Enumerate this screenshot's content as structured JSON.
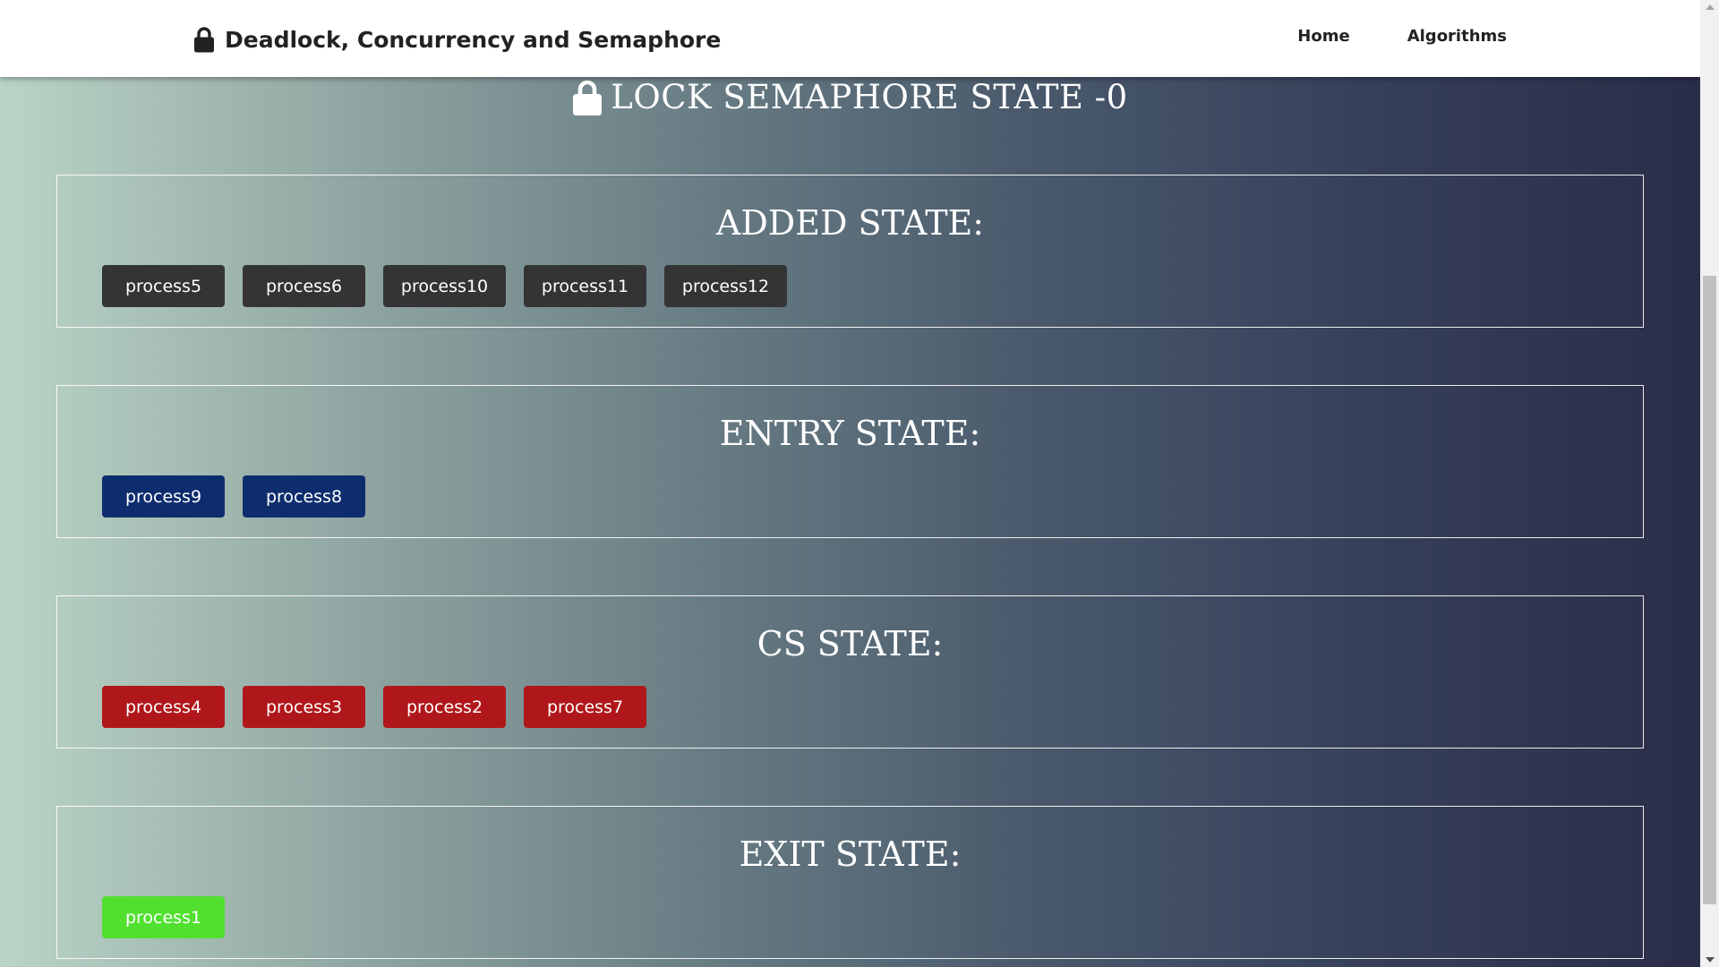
{
  "navbar": {
    "brand": "Deadlock, Concurrency and Semaphore",
    "brand_icon": "lock-icon",
    "links": [
      "Home",
      "Algorithms"
    ]
  },
  "lock_header": {
    "icon": "lock-icon",
    "text": "LOCK SEMAPHORE STATE -0"
  },
  "states": [
    {
      "title": "ADDED STATE:",
      "color": "#343434",
      "processes": [
        "process5",
        "process6",
        "process10",
        "process11",
        "process12"
      ]
    },
    {
      "title": "ENTRY STATE:",
      "color": "#0e2d6e",
      "processes": [
        "process9",
        "process8"
      ]
    },
    {
      "title": "CS STATE:",
      "color": "#b0171a",
      "processes": [
        "process4",
        "process3",
        "process2",
        "process7"
      ]
    },
    {
      "title": "EXIT STATE:",
      "color": "#52e030",
      "processes": [
        "process1"
      ]
    }
  ]
}
